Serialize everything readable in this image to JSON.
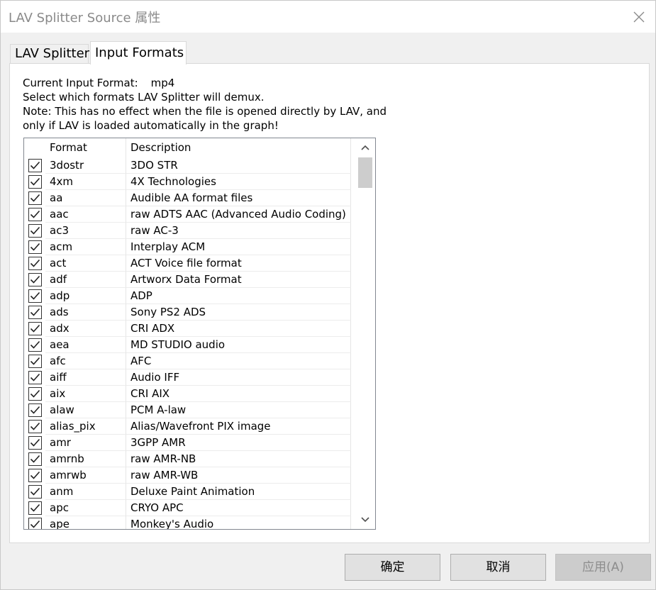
{
  "window": {
    "title": "LAV Splitter Source 属性"
  },
  "tabs": [
    {
      "label": "LAV Splitter"
    },
    {
      "label": "Input Formats"
    }
  ],
  "info": {
    "current_format_label": "Current Input Format:",
    "current_format_value": "mp4",
    "line2": "Select which formats LAV Splitter will demux.",
    "line3": "Note: This has no effect when the file is opened directly by LAV, and",
    "line4": "only if LAV is loaded automatically in the graph!"
  },
  "list": {
    "columns": {
      "format": "Format",
      "description": "Description"
    },
    "rows": [
      {
        "format": "3dostr",
        "description": "3DO STR",
        "checked": true
      },
      {
        "format": "4xm",
        "description": "4X Technologies",
        "checked": true
      },
      {
        "format": "aa",
        "description": "Audible AA format files",
        "checked": true
      },
      {
        "format": "aac",
        "description": "raw ADTS AAC (Advanced Audio Coding)",
        "checked": true
      },
      {
        "format": "ac3",
        "description": "raw AC-3",
        "checked": true
      },
      {
        "format": "acm",
        "description": "Interplay ACM",
        "checked": true
      },
      {
        "format": "act",
        "description": "ACT Voice file format",
        "checked": true
      },
      {
        "format": "adf",
        "description": "Artworx Data Format",
        "checked": true
      },
      {
        "format": "adp",
        "description": "ADP",
        "checked": true
      },
      {
        "format": "ads",
        "description": "Sony PS2 ADS",
        "checked": true
      },
      {
        "format": "adx",
        "description": "CRI ADX",
        "checked": true
      },
      {
        "format": "aea",
        "description": "MD STUDIO audio",
        "checked": true
      },
      {
        "format": "afc",
        "description": "AFC",
        "checked": true
      },
      {
        "format": "aiff",
        "description": "Audio IFF",
        "checked": true
      },
      {
        "format": "aix",
        "description": "CRI AIX",
        "checked": true
      },
      {
        "format": "alaw",
        "description": "PCM A-law",
        "checked": true
      },
      {
        "format": "alias_pix",
        "description": "Alias/Wavefront PIX image",
        "checked": true
      },
      {
        "format": "amr",
        "description": "3GPP AMR",
        "checked": true
      },
      {
        "format": "amrnb",
        "description": "raw AMR-NB",
        "checked": true
      },
      {
        "format": "amrwb",
        "description": "raw AMR-WB",
        "checked": true
      },
      {
        "format": "anm",
        "description": "Deluxe Paint Animation",
        "checked": true
      },
      {
        "format": "apc",
        "description": "CRYO APC",
        "checked": true
      },
      {
        "format": "ape",
        "description": "Monkey's Audio",
        "checked": true
      }
    ]
  },
  "buttons": {
    "ok": "确定",
    "cancel": "取消",
    "apply": "应用(A)"
  },
  "icons": {
    "close": "close-icon",
    "checkbox": "checkmark-icon",
    "scroll_up": "chevron-up-icon",
    "scroll_down": "chevron-down-icon"
  }
}
